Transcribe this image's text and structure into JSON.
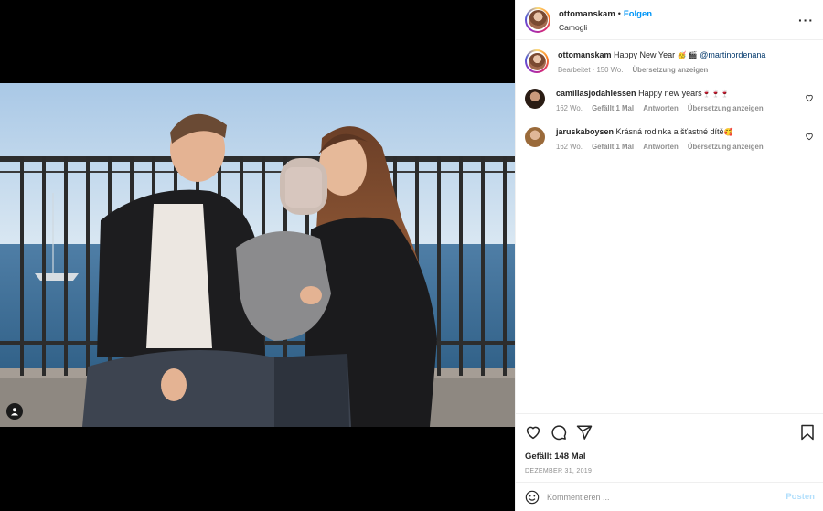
{
  "post": {
    "username": "ottomanskam",
    "dot": "•",
    "follow_label": "Folgen",
    "location": "Camogli",
    "more_label": "···"
  },
  "caption": {
    "username": "ottomanskam",
    "text": "Happy New Year",
    "emojis": "🥳 🎬",
    "mention": "@martinordenana",
    "meta_edited": "Bearbeitet · 150 Wo.",
    "meta_translate": "Übersetzung anzeigen"
  },
  "comments": [
    {
      "username": "camillasjodahlessen",
      "text": "Happy new years",
      "emoji": "🍷🍷🍷",
      "age": "162 Wo.",
      "likes": "Gefällt 1 Mal",
      "reply": "Antworten",
      "translate": "Übersetzung anzeigen"
    },
    {
      "username": "jaruskaboysen",
      "text": "Krásná rodinka a šťastné dítě",
      "emoji": "🥰",
      "age": "162 Wo.",
      "likes": "Gefällt 1 Mal",
      "reply": "Antworten",
      "translate": "Übersetzung anzeigen"
    }
  ],
  "engagement": {
    "likes": "Gefällt 148 Mal",
    "date": "DEZEMBER 31, 2019"
  },
  "comment_box": {
    "placeholder": "Kommentieren ...",
    "post_label": "Posten"
  },
  "icons": {
    "like": "heart-icon",
    "comment": "comment-icon",
    "share": "share-icon",
    "save": "bookmark-icon",
    "emoji": "emoji-icon",
    "tags": "user-tag-icon"
  },
  "colors": {
    "accent": "#0095f6",
    "post_disabled": "#b2dffc",
    "meta": "#8e8e8e"
  }
}
